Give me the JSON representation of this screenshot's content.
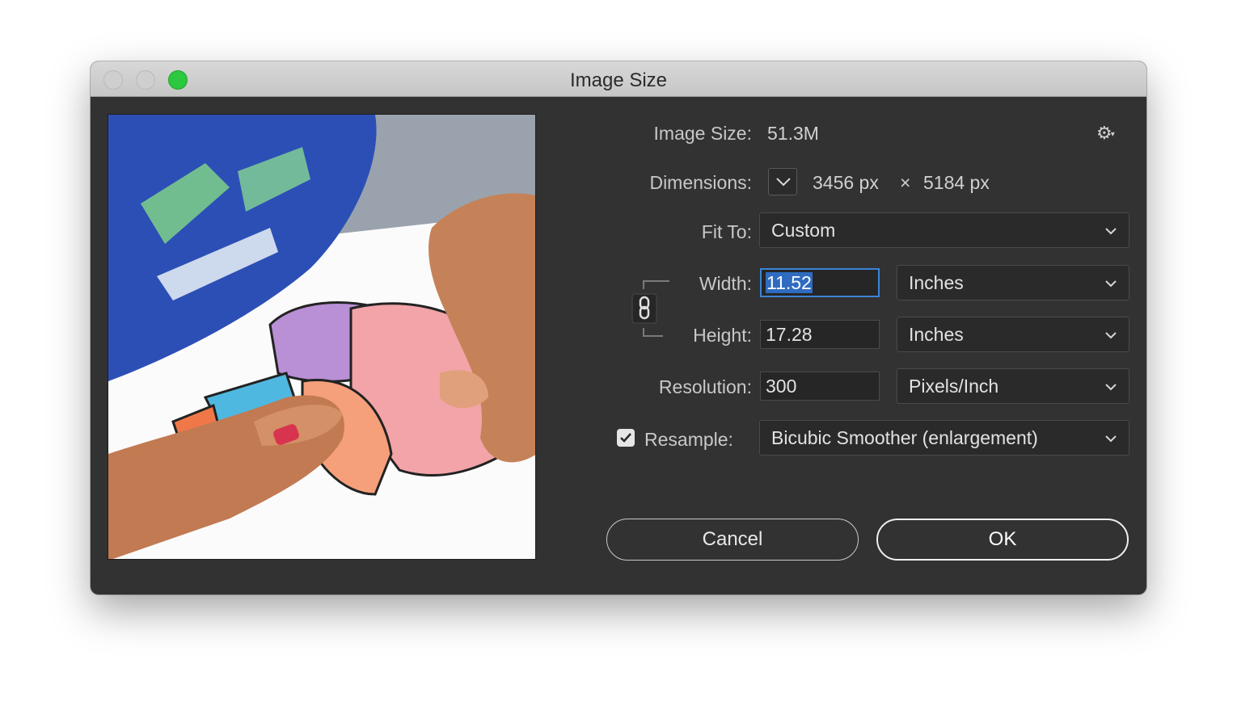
{
  "window": {
    "title": "Image Size"
  },
  "preview": {
    "image_description": "photo-preview"
  },
  "info": {
    "image_size_label": "Image Size:",
    "image_size_value": "51.3M",
    "dimensions_label": "Dimensions:",
    "dimensions_width": "3456 px",
    "dimensions_times": "×",
    "dimensions_height": "5184 px"
  },
  "fit_to": {
    "label": "Fit To:",
    "value": "Custom"
  },
  "width": {
    "label": "Width:",
    "value": "11.52",
    "unit": "Inches"
  },
  "height": {
    "label": "Height:",
    "value": "17.28",
    "unit": "Inches"
  },
  "resolution": {
    "label": "Resolution:",
    "value": "300",
    "unit": "Pixels/Inch"
  },
  "resample": {
    "label": "Resample:",
    "checked": true,
    "method": "Bicubic Smoother (enlargement)"
  },
  "buttons": {
    "cancel": "Cancel",
    "ok": "OK"
  },
  "colors": {
    "dialog_bg": "#323232",
    "focus_ring": "#3b84d8",
    "zoom_button": "#2bc840"
  },
  "icons": {
    "settings": "gear-icon",
    "constrain": "chain-link-icon",
    "dropdown": "chevron-down-icon",
    "checkbox": "checkmark-icon"
  }
}
